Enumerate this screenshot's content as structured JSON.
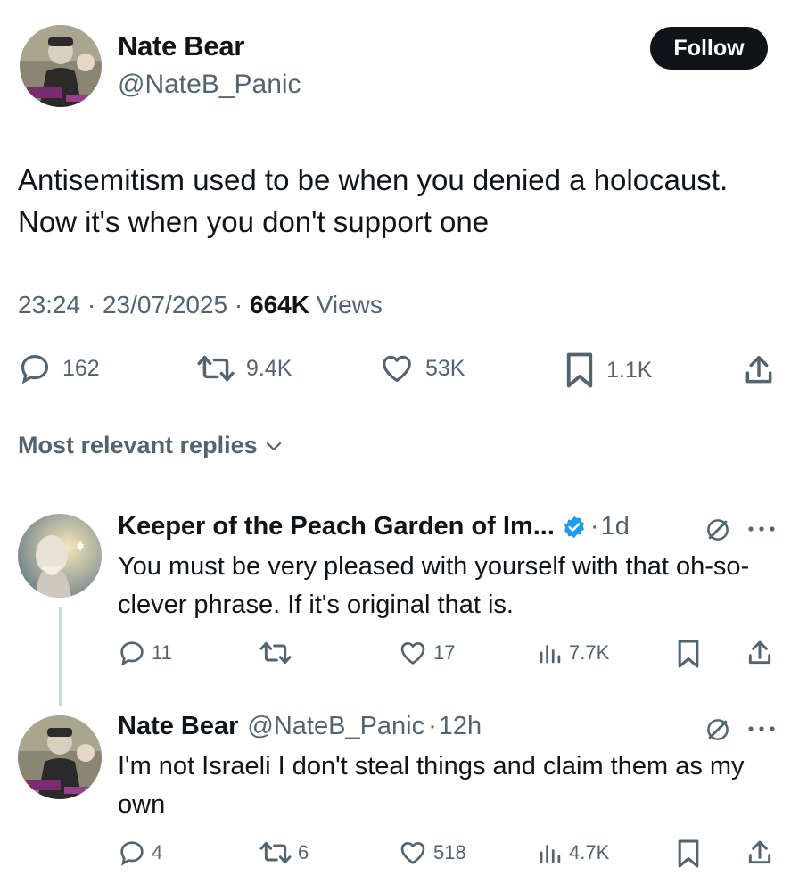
{
  "main_tweet": {
    "author_name": "Nate Bear",
    "author_handle": "@NateB_Panic",
    "follow_label": "Follow",
    "text": "Antisemitism used to be when you denied a holocaust. Now it's when you don't support one",
    "time": "23:24",
    "date": "23/07/2025",
    "views_count": "664K",
    "views_label": "Views",
    "actions": {
      "replies": "162",
      "reposts": "9.4K",
      "likes": "53K",
      "bookmarks": "1.1K"
    }
  },
  "sort_label": "Most relevant replies",
  "replies": [
    {
      "author_name": "Keeper of the Peach Garden of Im...",
      "verified": true,
      "age": "1d",
      "text": "You must be very pleased with yourself with that oh-so-clever phrase. If it's original that is.",
      "actions": {
        "replies": "11",
        "reposts": "",
        "likes": "17",
        "views": "7.7K"
      }
    },
    {
      "author_name": "Nate Bear",
      "author_handle": "@NateB_Panic",
      "age": "12h",
      "text": "I'm not Israeli I don't steal things and claim them as my own",
      "actions": {
        "replies": "4",
        "reposts": "6",
        "likes": "518",
        "views": "4.7K"
      }
    }
  ],
  "colors": {
    "text": "#0f1419",
    "secondary": "#536471",
    "verified": "#1d9bf0",
    "divider": "#eff3f4"
  }
}
